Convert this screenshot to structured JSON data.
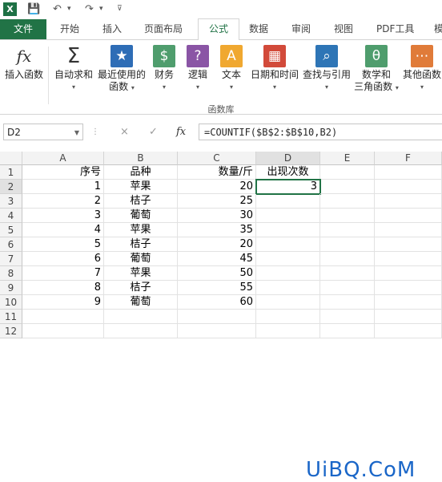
{
  "qat": {
    "app_icon": "X",
    "save_icon": "save-icon",
    "undo_icon": "undo-icon",
    "redo_icon": "redo-icon"
  },
  "tabs": [
    "文件",
    "开始",
    "插入",
    "页面布局",
    "公式",
    "数据",
    "审阅",
    "视图",
    "PDF工具",
    "模"
  ],
  "active_tab": "公式",
  "ribbon": {
    "buttons": [
      {
        "label": "插入函数",
        "icon": "fx-icon",
        "glyph": "fx",
        "color": "#ffffff"
      },
      {
        "label": "自动求和",
        "icon": "sigma-icon",
        "glyph": "Σ",
        "color": "#ffffff"
      },
      {
        "label": "最近使用的",
        "label2": "函数",
        "icon": "star-icon",
        "glyph": "★",
        "color": "#2e6db6"
      },
      {
        "label": "财务",
        "icon": "coins-icon",
        "glyph": "$",
        "color": "#4f9d6d"
      },
      {
        "label": "逻辑",
        "icon": "question-icon",
        "glyph": "?",
        "color": "#8a55a5"
      },
      {
        "label": "文本",
        "icon": "text-a-icon",
        "glyph": "A",
        "color": "#f0a830"
      },
      {
        "label": "日期和时间",
        "icon": "calendar-icon",
        "glyph": "▦",
        "color": "#d24a3a"
      },
      {
        "label": "查找与引用",
        "icon": "lookup-icon",
        "glyph": "⌕",
        "color": "#2e75b6"
      },
      {
        "label": "数学和",
        "label2": "三角函数",
        "icon": "theta-icon",
        "glyph": "θ",
        "color": "#4f9d6d"
      },
      {
        "label": "其他函数",
        "icon": "more-functions-icon",
        "glyph": "⋯",
        "color": "#e07b39"
      }
    ],
    "group_label": "函数库"
  },
  "formula_bar": {
    "name_box": "D2",
    "cancel_icon": "×",
    "enter_icon": "✓",
    "fx_label": "fx",
    "formula": "=COUNTIF($B$2:$B$10,B2)"
  },
  "columns": [
    "A",
    "B",
    "C",
    "D",
    "E",
    "F"
  ],
  "rows": [
    "1",
    "2",
    "3",
    "4",
    "5",
    "6",
    "7",
    "8",
    "9",
    "10",
    "11",
    "12"
  ],
  "table": {
    "header": [
      "序号",
      "品种",
      "数量/斤",
      "出现次数"
    ],
    "data": [
      [
        "1",
        "苹果",
        "20",
        "3"
      ],
      [
        "2",
        "桔子",
        "25",
        ""
      ],
      [
        "3",
        "葡萄",
        "30",
        ""
      ],
      [
        "4",
        "苹果",
        "35",
        ""
      ],
      [
        "5",
        "桔子",
        "20",
        ""
      ],
      [
        "6",
        "葡萄",
        "45",
        ""
      ],
      [
        "7",
        "苹果",
        "50",
        ""
      ],
      [
        "8",
        "桔子",
        "55",
        ""
      ],
      [
        "9",
        "葡萄",
        "60",
        ""
      ]
    ]
  },
  "watermark": "UiBQ.CoM",
  "colors": {
    "excel_green": "#217346",
    "watermark": "#1a66c8"
  }
}
